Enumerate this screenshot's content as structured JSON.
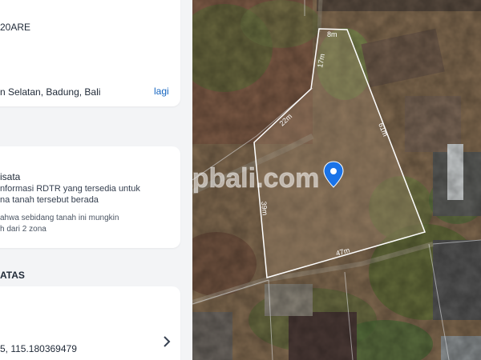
{
  "panel": {
    "area_text": "20ARE",
    "location_text": "n Selatan, Badung, Bali",
    "more_link": "lagi",
    "zone_title": "isata",
    "zone_info_line1": "nformasi RDTR yang tersedia untuk",
    "zone_info_line2": "na tanah tersebut berada",
    "zone_note_line1": "ahwa sebidang tanah ini mungkin",
    "zone_note_line2": "h dari 2 zona",
    "section_heading": "ATAS",
    "coordinates": "5, 115.180369479"
  },
  "map": {
    "watermark": "dapbali.com",
    "measurements": [
      "8m",
      "17m",
      "22m",
      "61m",
      "39m",
      "47m"
    ],
    "pin_color": "#1a73e8",
    "accent_color": "#1565c0"
  }
}
